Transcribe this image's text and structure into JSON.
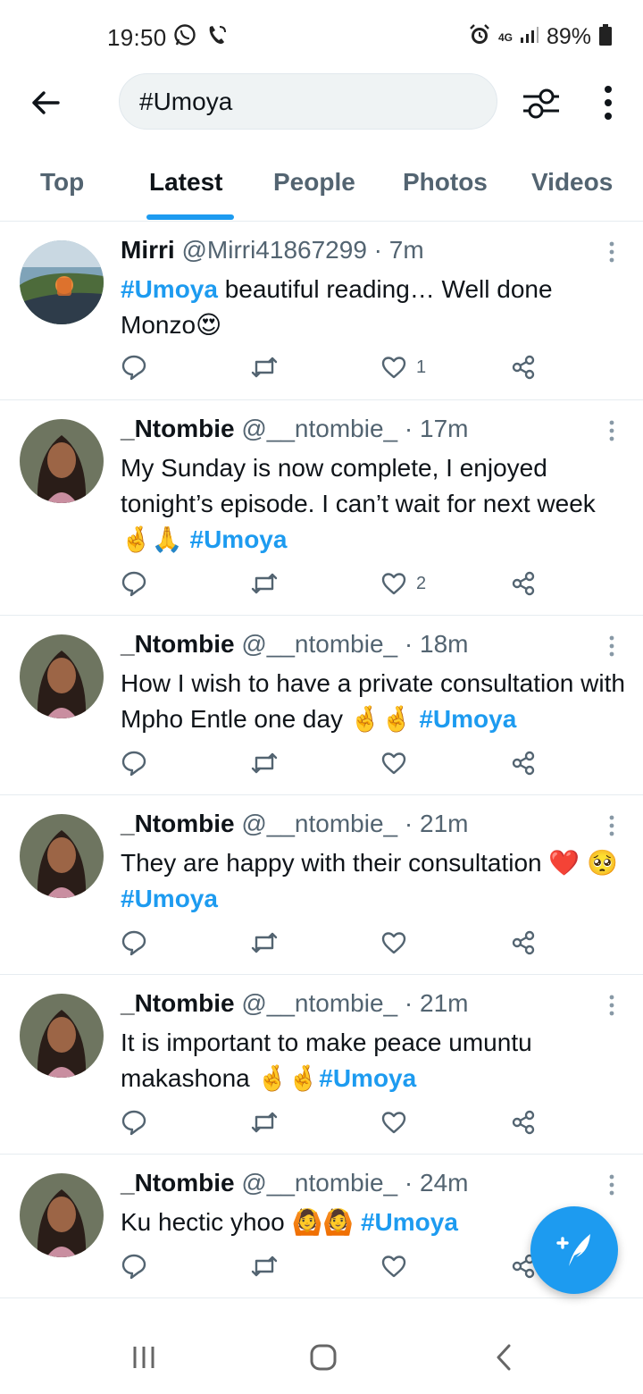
{
  "status_bar": {
    "time": "19:50",
    "network": "4G",
    "battery": "89%"
  },
  "search": {
    "query": "#Umoya"
  },
  "tabs": [
    {
      "label": "Top",
      "active": false
    },
    {
      "label": "Latest",
      "active": true
    },
    {
      "label": "People",
      "active": false
    },
    {
      "label": "Photos",
      "active": false
    },
    {
      "label": "Videos",
      "active": false
    }
  ],
  "colors": {
    "accent": "#1d9bf0",
    "text": "#0f1419",
    "muted": "#536471",
    "like_icon": "#536471"
  },
  "tweets": [
    {
      "name": "Mirri",
      "handle": "@Mirri41867299",
      "time": "7m",
      "text_before": "",
      "hashtag": "#Umoya",
      "text_after": " beautiful reading… Well done Monzo😍",
      "likes": "1"
    },
    {
      "name": "_Ntombie",
      "handle": "@__ntombie_",
      "time": "17m",
      "text_before": "My Sunday is now complete, I enjoyed tonight’s episode. I can’t wait for next week 🤞🙏 ",
      "hashtag": "#Umoya",
      "text_after": "",
      "likes": "2"
    },
    {
      "name": "_Ntombie",
      "handle": "@__ntombie_",
      "time": "18m",
      "text_before": "How I wish to have a private consultation with Mpho Entle one day 🤞🤞 ",
      "hashtag": "#Umoya",
      "text_after": "",
      "likes": ""
    },
    {
      "name": "_Ntombie",
      "handle": "@__ntombie_",
      "time": "21m",
      "text_before": "They are happy with their consultation ❤️ 🥺 ",
      "hashtag": "#Umoya",
      "text_after": "",
      "likes": ""
    },
    {
      "name": "_Ntombie",
      "handle": "@__ntombie_",
      "time": "21m",
      "text_before": "It is important to make peace umuntu makashona 🤞🤞",
      "hashtag": "#Umoya",
      "text_after": "",
      "likes": ""
    },
    {
      "name": "_Ntombie",
      "handle": "@__ntombie_",
      "time": "24m",
      "text_before": "Ku hectic yhoo 🙆🙆 ",
      "hashtag": "#Umoya",
      "text_after": "",
      "likes": ""
    }
  ],
  "icons": {
    "status_left": [
      "whatsapp-icon",
      "wifi-call-icon"
    ],
    "status_right": [
      "alarm-icon",
      "signal-icon",
      "battery-icon"
    ],
    "top_bar": [
      "back-arrow-icon",
      "filter-icon",
      "more-vertical-icon"
    ],
    "tweet_actions": [
      "reply-icon",
      "retweet-icon",
      "like-icon",
      "share-icon"
    ],
    "fab": "compose-tweet-icon",
    "nav": [
      "recent-apps-icon",
      "home-icon",
      "back-icon"
    ]
  }
}
